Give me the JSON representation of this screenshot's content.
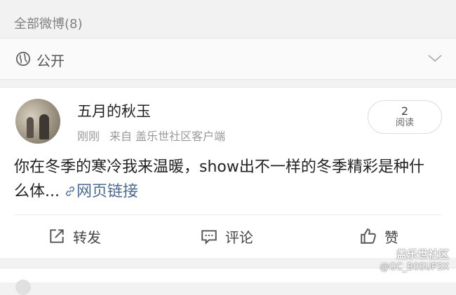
{
  "section": {
    "title": "全部微博(8)"
  },
  "visibility": {
    "label": "公开"
  },
  "post": {
    "username": "五月的秋玉",
    "time": "刚刚",
    "source": "来自 盖乐世社区客户端",
    "reads": {
      "count": "2",
      "label": "阅读"
    },
    "text": "你在冬季的寒冷我来温暖，show出不一样的冬季精彩是种什么体...",
    "link_label": "网页链接"
  },
  "actions": {
    "repost": "转发",
    "comment": "评论",
    "like": "赞"
  },
  "watermark": {
    "title": "盖乐世社区",
    "handle": "@GC_B0SUP3X"
  },
  "icons": {
    "visibility": "globe-icon",
    "expand": "chevron-down-icon",
    "link": "link-icon",
    "repost": "repost-icon",
    "comment": "comment-icon",
    "like": "thumbs-up-icon"
  }
}
